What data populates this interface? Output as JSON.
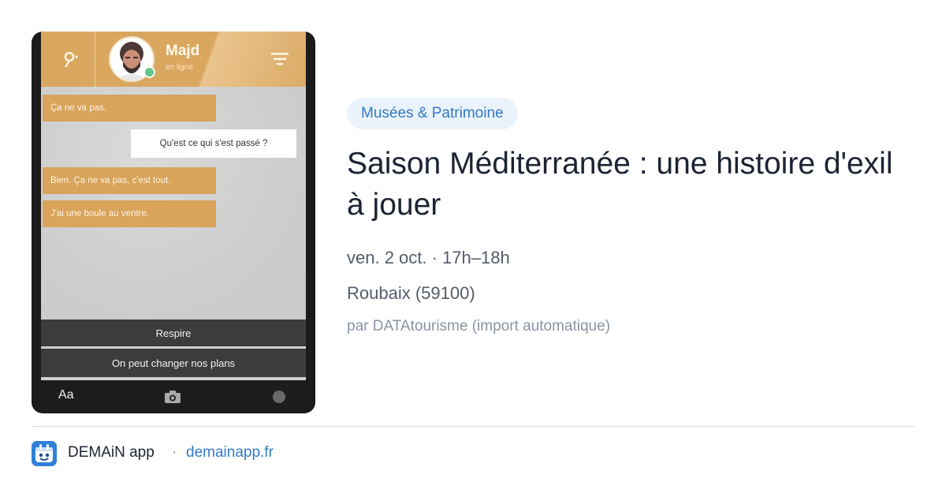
{
  "preview_image": {
    "contact": {
      "name": "Majd",
      "status": "en ligne"
    },
    "messages": [
      {
        "side": "in",
        "text": "Ça ne va pas."
      },
      {
        "side": "out",
        "text": "Qu'est ce qui s'est passé ?"
      },
      {
        "side": "in",
        "text": "Bien. Ça ne va pas, c'est tout."
      },
      {
        "side": "in",
        "text": "J'ai une boule au ventre."
      }
    ],
    "choices": [
      "Respire",
      "On peut changer nos plans"
    ],
    "input_bar": {
      "text_format_label": "Aa"
    },
    "colors": {
      "header": "#d9a75f",
      "bubble_in": "#d8a35a",
      "choice_bg": "#3c3c3c"
    },
    "icons": [
      "map-pin-icon",
      "filter-icon",
      "camera-icon",
      "record-icon"
    ]
  },
  "event": {
    "category": "Musées & Patrimoine",
    "title": "Saison Méditerranée : une histoire d'exil à jouer",
    "datetime": "ven. 2 oct. · 17h–18h",
    "location": "Roubaix (59100)",
    "source": "par DATAtourisme (import automatique)"
  },
  "footer": {
    "app_name": "DEMAiN app",
    "separator": "·",
    "url": "demainapp.fr"
  },
  "colors": {
    "accent": "#3479c5",
    "tag_bg": "#eaf3fb",
    "title": "#1c2333",
    "meta": "#545c6a"
  }
}
